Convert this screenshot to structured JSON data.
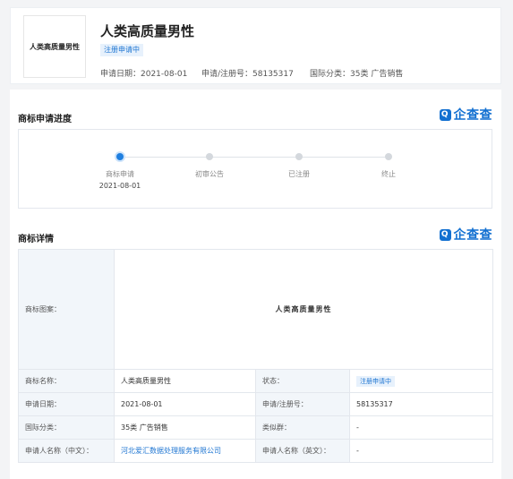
{
  "header": {
    "thumb_text": "人类高质量男性",
    "title": "人类高质量男性",
    "status_tag": "注册申请中",
    "apply_date": "申请日期：2021-08-01",
    "reg_no": "申请/注册号：58135317",
    "class": "国际分类：35类 广告销售"
  },
  "progress": {
    "title": "商标申请进度",
    "steps": [
      {
        "label": "商标申请",
        "date": "2021-08-01"
      },
      {
        "label": "初审公告",
        "date": ""
      },
      {
        "label": "已注册",
        "date": ""
      },
      {
        "label": "终止",
        "date": ""
      }
    ]
  },
  "details": {
    "title": "商标详情",
    "image_label": "商标图案：",
    "image_text": "人类高质量男性",
    "rows": [
      {
        "l1": "商标名称：",
        "v1": "人类高质量男性",
        "l2": "状态：",
        "v2": "注册申请中"
      },
      {
        "l1": "申请日期：",
        "v1": "2021-08-01",
        "l2": "申请/注册号：",
        "v2": "58135317"
      },
      {
        "l1": "国际分类：",
        "v1": "35类 广告销售",
        "l2": "类似群：",
        "v2": "-"
      },
      {
        "l1": "申请人名称（中文）：",
        "v1": "河北爱汇数据处理服务有限公司",
        "l2": "申请人名称（英文）：",
        "v2": "-"
      }
    ]
  },
  "brand": {
    "logo_text": "企查查",
    "icon": "qcc-logo-icon"
  },
  "colors": {
    "accent": "#1f7fe0",
    "tag_bg": "#e7f1fc",
    "label_bg": "#f2f6fa"
  }
}
